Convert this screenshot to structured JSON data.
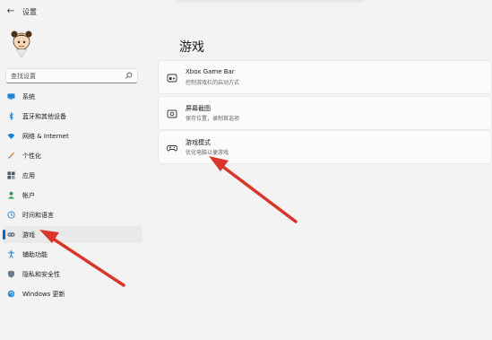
{
  "titlebar": {
    "back_glyph": "←",
    "title": "设置"
  },
  "sidebar": {
    "search_placeholder": "查找设置",
    "items": [
      {
        "label": "系统",
        "icon": "system-monitor-icon"
      },
      {
        "label": "蓝牙和其他设备",
        "icon": "bluetooth-icon"
      },
      {
        "label": "网络 & Internet",
        "icon": "wifi-icon"
      },
      {
        "label": "个性化",
        "icon": "pen-brush-icon"
      },
      {
        "label": "应用",
        "icon": "apps-icon"
      },
      {
        "label": "帐户",
        "icon": "person-icon"
      },
      {
        "label": "时间和语言",
        "icon": "globe-clock-icon"
      },
      {
        "label": "游戏",
        "icon": "gamepad-icon",
        "selected": true
      },
      {
        "label": "辅助功能",
        "icon": "accessibility-icon"
      },
      {
        "label": "隐私和安全性",
        "icon": "shield-icon"
      },
      {
        "label": "Windows 更新",
        "icon": "update-icon"
      }
    ]
  },
  "main": {
    "title": "游戏",
    "cards": [
      {
        "title": "Xbox Game Bar",
        "desc": "控制游戏栏的启动方式",
        "icon": "game-bar-icon"
      },
      {
        "title": "屏幕截图",
        "desc": "保存位置，录制首选项",
        "icon": "capture-icon"
      },
      {
        "title": "游戏模式",
        "desc": "优化电脑以便游戏",
        "icon": "controller-icon"
      }
    ]
  },
  "colors": {
    "accent": "#0067c0",
    "annotation_arrow": "#d9352b",
    "background": "#f3f3f3",
    "card": "#fbfbfb"
  }
}
